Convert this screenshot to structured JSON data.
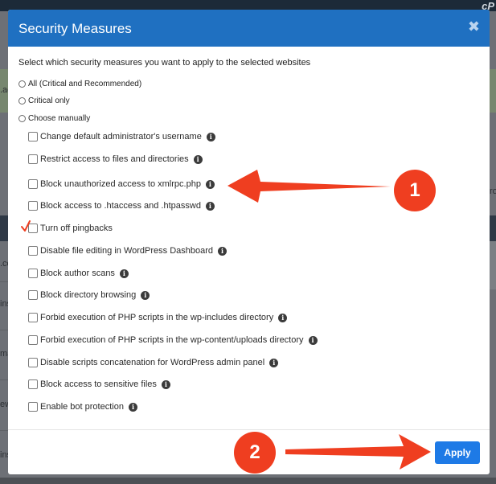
{
  "background": {
    "logo": "cP",
    "fragments_left": [
      ".ad",
      ".co",
      "ins",
      "mai",
      "ew",
      "ins"
    ],
    "fragment_right": "ro"
  },
  "modal": {
    "title": "Security Measures",
    "close_icon": "close-icon",
    "intro": "Select which security measures you want to apply to the selected websites",
    "radios": [
      {
        "label": "All (Critical and Recommended)"
      },
      {
        "label": "Critical only"
      },
      {
        "label": "Choose manually"
      }
    ],
    "measures": [
      {
        "label": "Change default administrator's username"
      },
      {
        "label": "Restrict access to files and directories"
      },
      {
        "label": "Block unauthorized access to xmlrpc.php"
      },
      {
        "label": "Block access to .htaccess and .htpasswd"
      },
      {
        "label": "Turn off pingbacks"
      },
      {
        "label": "Disable file editing in WordPress Dashboard"
      },
      {
        "label": "Block author scans"
      },
      {
        "label": "Block directory browsing"
      },
      {
        "label": "Forbid execution of PHP scripts in the wp-includes directory"
      },
      {
        "label": "Forbid execution of PHP scripts in the wp-content/uploads directory"
      },
      {
        "label": "Disable scripts concatenation for WordPress admin panel"
      },
      {
        "label": "Block access to sensitive files"
      },
      {
        "label": "Enable bot protection"
      }
    ],
    "apply_label": "Apply"
  },
  "annotations": {
    "badge_1": "1",
    "badge_2": "2",
    "accent_color": "#ef3e20"
  }
}
